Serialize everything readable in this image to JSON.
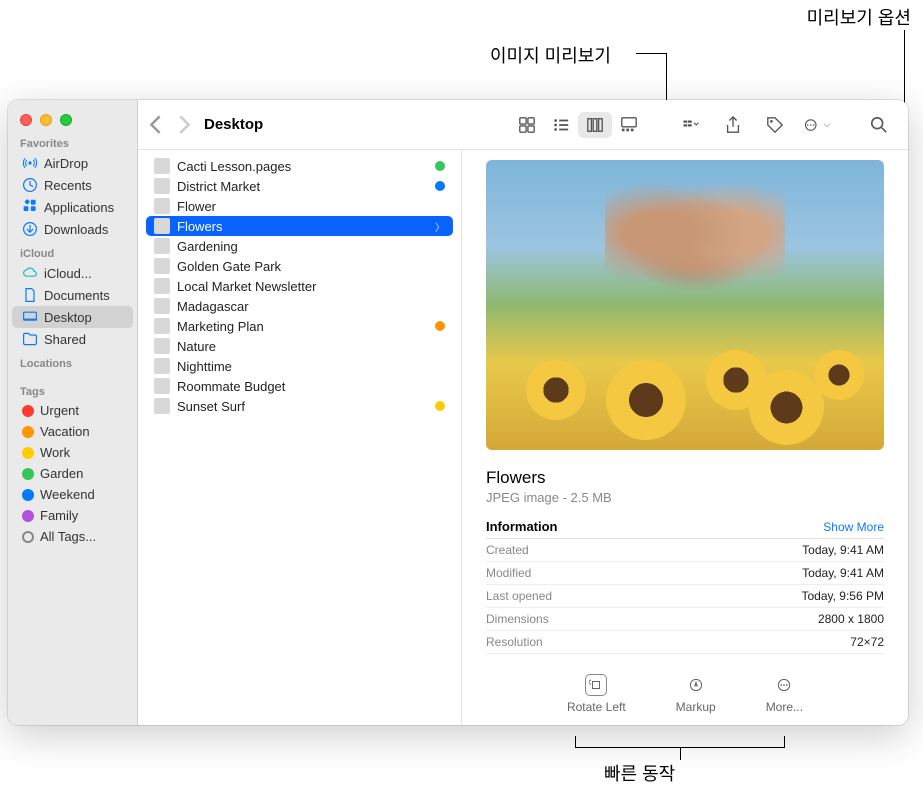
{
  "annotations": {
    "preview_options": "미리보기 옵션",
    "image_preview": "이미지 미리보기",
    "quick_actions": "빠른 동작"
  },
  "window": {
    "title": "Desktop"
  },
  "sidebar": {
    "sections": {
      "favorites": {
        "label": "Favorites",
        "items": [
          {
            "name": "AirDrop",
            "icon": "airdrop"
          },
          {
            "name": "Recents",
            "icon": "clock"
          },
          {
            "name": "Applications",
            "icon": "apps"
          },
          {
            "name": "Downloads",
            "icon": "download"
          }
        ]
      },
      "icloud": {
        "label": "iCloud",
        "items": [
          {
            "name": "iCloud...",
            "icon": "cloud"
          },
          {
            "name": "Documents",
            "icon": "doc"
          },
          {
            "name": "Desktop",
            "icon": "desktop",
            "selected": true
          },
          {
            "name": "Shared",
            "icon": "shared"
          }
        ]
      },
      "locations": {
        "label": "Locations"
      },
      "tags": {
        "label": "Tags",
        "items": [
          {
            "name": "Urgent",
            "color": "#ff3b30"
          },
          {
            "name": "Vacation",
            "color": "#ff9500"
          },
          {
            "name": "Work",
            "color": "#ffcc00"
          },
          {
            "name": "Garden",
            "color": "#34c759"
          },
          {
            "name": "Weekend",
            "color": "#007aff"
          },
          {
            "name": "Family",
            "color": "#af52de"
          },
          {
            "name": "All Tags...",
            "all": true
          }
        ]
      }
    }
  },
  "files": [
    {
      "name": "Cacti Lesson.pages",
      "tag": "#34c759"
    },
    {
      "name": "District Market",
      "tag": "#007aff"
    },
    {
      "name": "Flower"
    },
    {
      "name": "Flowers",
      "selected": true
    },
    {
      "name": "Gardening"
    },
    {
      "name": "Golden Gate Park"
    },
    {
      "name": "Local Market Newsletter"
    },
    {
      "name": "Madagascar"
    },
    {
      "name": "Marketing Plan",
      "tag": "#ff9500"
    },
    {
      "name": "Nature"
    },
    {
      "name": "Nighttime"
    },
    {
      "name": "Roommate Budget"
    },
    {
      "name": "Sunset Surf",
      "tag": "#ffcc00"
    }
  ],
  "preview": {
    "title": "Flowers",
    "subtitle": "JPEG image - 2.5 MB",
    "info_header": "Information",
    "show_more": "Show More",
    "info": [
      {
        "label": "Created",
        "value": "Today, 9:41 AM"
      },
      {
        "label": "Modified",
        "value": "Today, 9:41 AM"
      },
      {
        "label": "Last opened",
        "value": "Today, 9:56 PM"
      },
      {
        "label": "Dimensions",
        "value": "2800 x 1800"
      },
      {
        "label": "Resolution",
        "value": "72×72"
      }
    ],
    "actions": [
      {
        "label": "Rotate Left",
        "icon": "rotate"
      },
      {
        "label": "Markup",
        "icon": "markup"
      },
      {
        "label": "More...",
        "icon": "more"
      }
    ]
  }
}
